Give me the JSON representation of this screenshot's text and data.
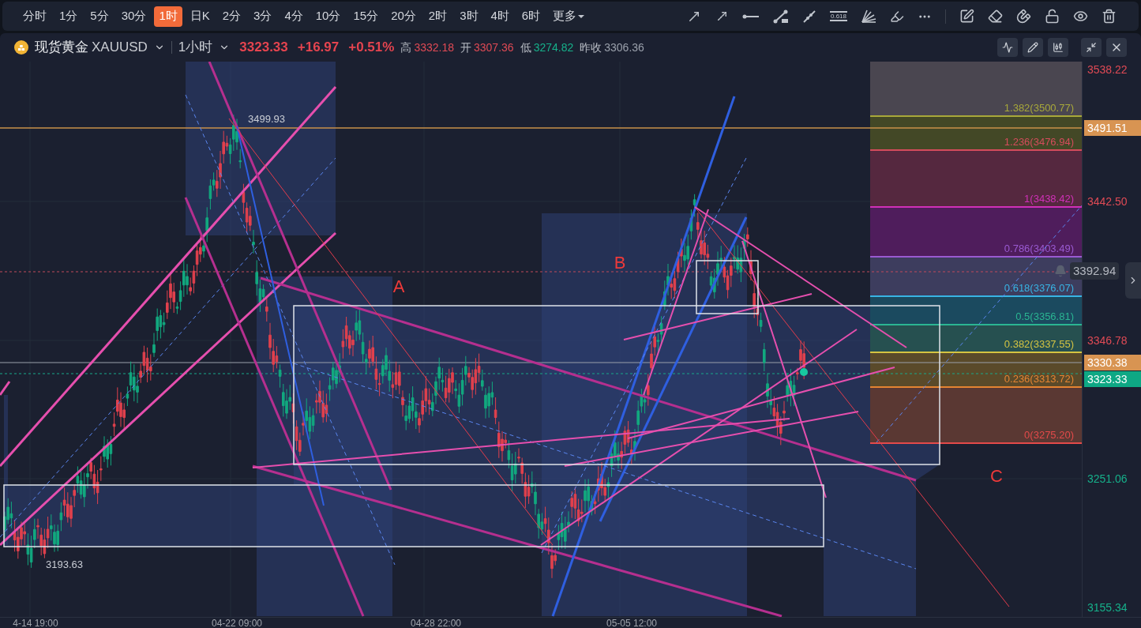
{
  "toolbar": {
    "intervals": [
      {
        "label": "分时",
        "selected": false
      },
      {
        "label": "1分",
        "selected": false
      },
      {
        "label": "5分",
        "selected": false
      },
      {
        "label": "30分",
        "selected": false
      },
      {
        "label": "1时",
        "selected": true
      },
      {
        "label": "日K",
        "selected": false
      },
      {
        "label": "2分",
        "selected": false
      },
      {
        "label": "3分",
        "selected": false
      },
      {
        "label": "4分",
        "selected": false
      },
      {
        "label": "10分",
        "selected": false
      },
      {
        "label": "15分",
        "selected": false
      },
      {
        "label": "20分",
        "selected": false
      },
      {
        "label": "2时",
        "selected": false
      },
      {
        "label": "3时",
        "selected": false
      },
      {
        "label": "4时",
        "selected": false
      },
      {
        "label": "6时",
        "selected": false
      }
    ],
    "more": "更多",
    "fib_tool_label": "0.618"
  },
  "header": {
    "name": "现货黄金",
    "symbol": "XAUUSD",
    "period": "1小时",
    "price": "3323.33",
    "change": "+16.97",
    "change_pct": "+0.51%",
    "stats": [
      {
        "label": "高",
        "value": "3332.18",
        "color": "#e04a55"
      },
      {
        "label": "开",
        "value": "3307.36",
        "color": "#e04a55"
      },
      {
        "label": "低",
        "value": "3274.82",
        "color": "#16b08a"
      },
      {
        "label": "昨收",
        "value": "3306.36",
        "color": "#9aa0ab"
      }
    ]
  },
  "chart": {
    "labels": [
      {
        "text": "A"
      },
      {
        "text": "B"
      },
      {
        "text": "C"
      }
    ],
    "high_marker": "3499.93",
    "low_marker": "3193.63",
    "fib_levels": [
      {
        "label": "1.382(3500.77)",
        "color": "#a8a83a"
      },
      {
        "label": "1.236(3476.94)",
        "color": "#d44c5c"
      },
      {
        "label": "1(3438.42)",
        "color": "#d030b8"
      },
      {
        "label": "0.786(3403.49)",
        "color": "#9a5ad2"
      },
      {
        "label": "0.618(3376.07)",
        "color": "#38b4e4"
      },
      {
        "label": "0.5(3356.81)",
        "color": "#2ab592"
      },
      {
        "label": "0.382(3337.55)",
        "color": "#d4c442"
      },
      {
        "label": "0.236(3313.72)",
        "color": "#e48432"
      },
      {
        "label": "0(3275.20)",
        "color": "#e44a4a"
      }
    ],
    "price_axis": [
      {
        "text": "3538.22",
        "kind": "plain",
        "color": "#e04a55"
      },
      {
        "text": "3491.51",
        "kind": "tag",
        "color": "#d89452"
      },
      {
        "text": "3442.50",
        "kind": "plain",
        "color": "#e04a55"
      },
      {
        "text": "3392.94",
        "kind": "alert",
        "color": "#2a303c"
      },
      {
        "text": "3346.78",
        "kind": "plain",
        "color": "#e04a55"
      },
      {
        "text": "3330.38",
        "kind": "tag",
        "color": "#d89452"
      },
      {
        "text": "3323.33",
        "kind": "tag",
        "color": "#0ea884"
      },
      {
        "text": "3251.06",
        "kind": "plain",
        "color": "#16b08a"
      },
      {
        "text": "3155.34",
        "kind": "plain",
        "color": "#16b08a"
      }
    ],
    "time_axis": [
      "4-14 19:00",
      "04-22 09:00",
      "04-28 22:00",
      "05-05 12:00"
    ]
  }
}
